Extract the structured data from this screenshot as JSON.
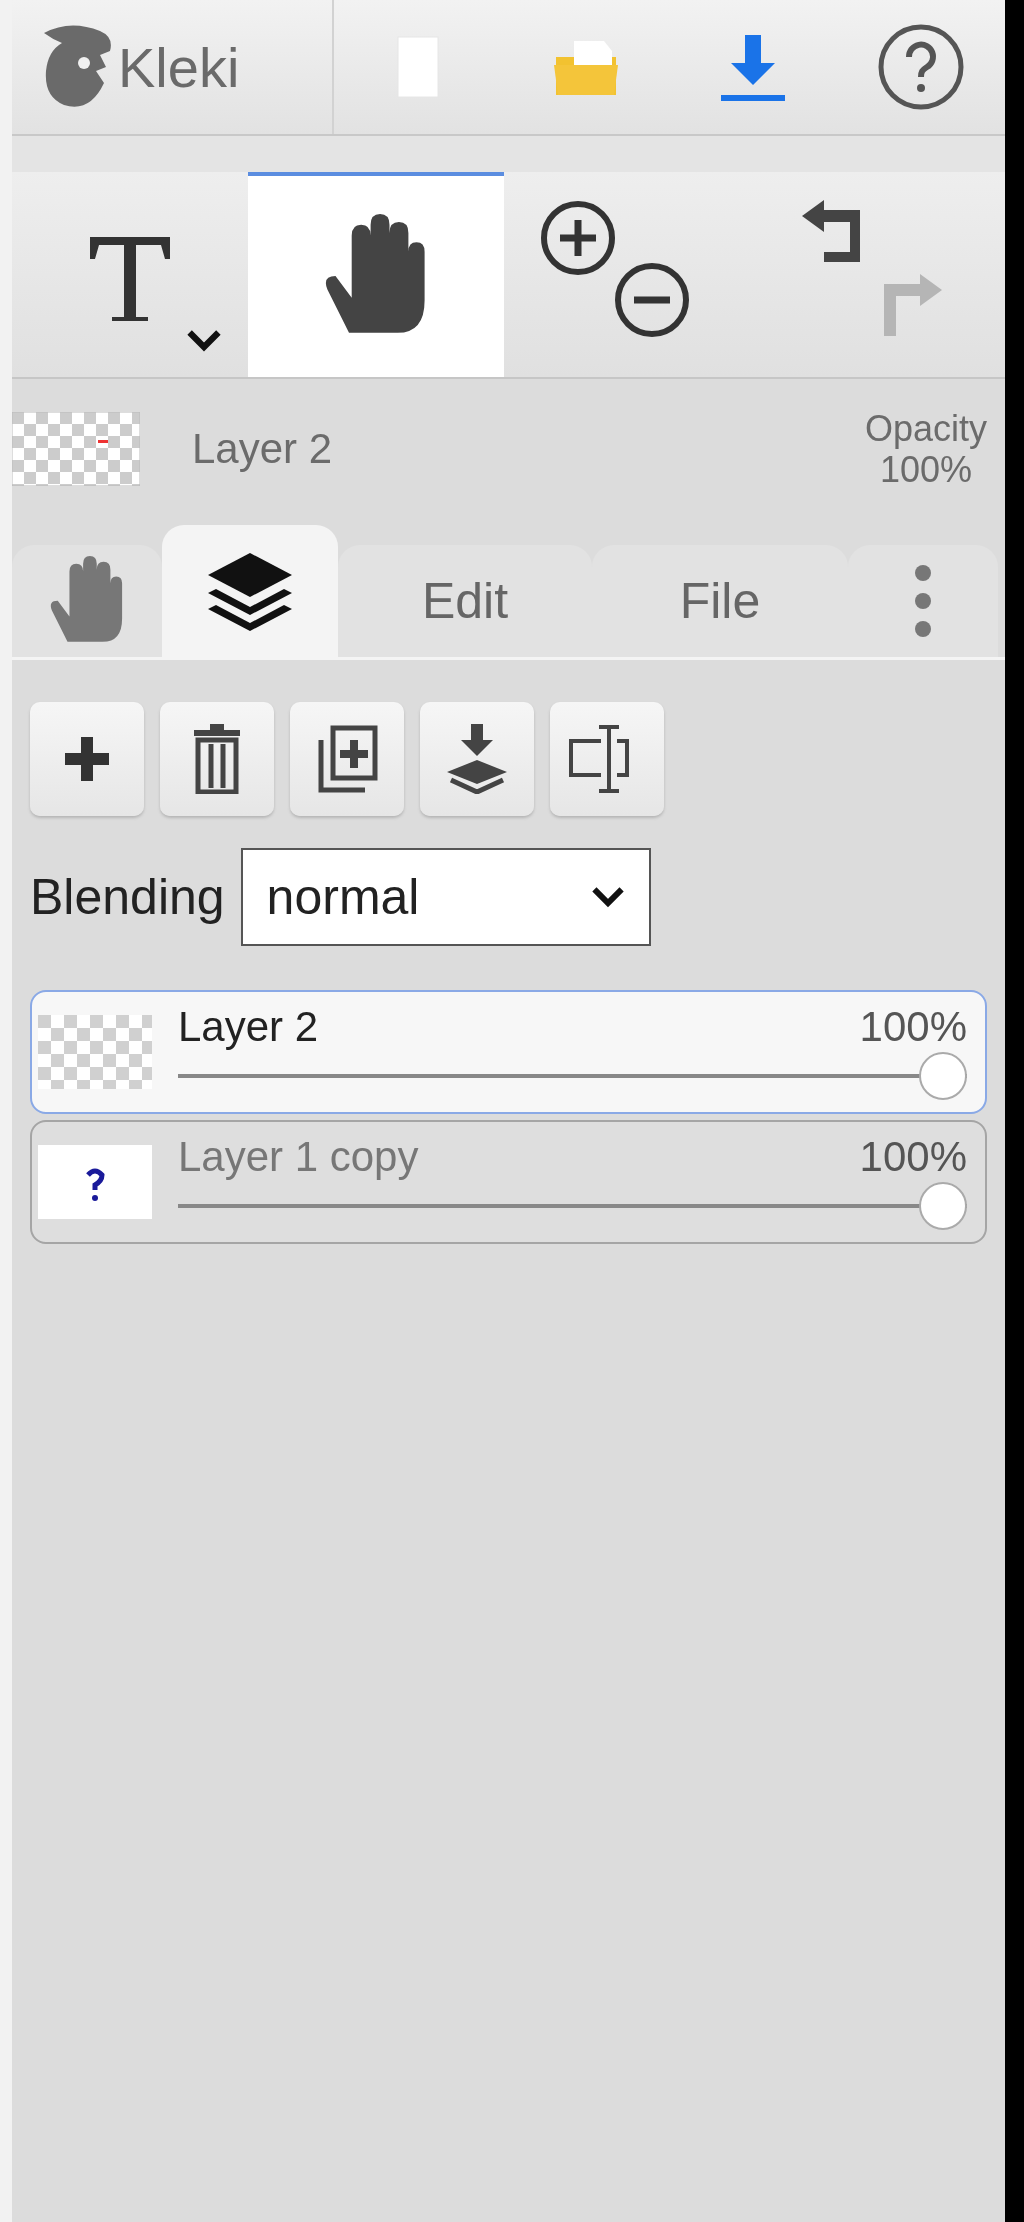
{
  "header": {
    "logo": "Kleki",
    "buttons": [
      {
        "kind": "new"
      },
      {
        "kind": "open"
      },
      {
        "kind": "save"
      },
      {
        "kind": "help"
      }
    ]
  },
  "toolbar": {
    "tools": [
      {
        "kind": "text",
        "selected": false
      },
      {
        "kind": "hand",
        "selected": true
      }
    ],
    "zoom": [
      {
        "kind": "in"
      },
      {
        "kind": "out"
      }
    ],
    "history": [
      {
        "kind": "undo",
        "disabled": false
      },
      {
        "kind": "redo",
        "disabled": true
      }
    ]
  },
  "layer_info": {
    "name": "Layer 2",
    "opacity_label": "Opacity",
    "opacity": "100%"
  },
  "tabs": [
    {
      "kind": "hand",
      "selected": false
    },
    {
      "kind": "layers",
      "selected": true
    },
    {
      "kind": "text",
      "label": "Edit",
      "selected": false
    },
    {
      "kind": "text",
      "label": "File",
      "selected": false
    },
    {
      "kind": "more",
      "selected": false
    }
  ],
  "layer_actions": [
    {
      "kind": "add"
    },
    {
      "kind": "delete"
    },
    {
      "kind": "duplicate"
    },
    {
      "kind": "merge"
    },
    {
      "kind": "rename"
    }
  ],
  "blending": {
    "label": "Blending",
    "value": "normal"
  },
  "layers": [
    {
      "name": "Layer 2",
      "opacity": "100%",
      "level": 1,
      "selected": true,
      "kind": "empty"
    },
    {
      "name": "Layer 1 copy",
      "opacity": "100%",
      "level": 1,
      "selected": false,
      "kind": "mark"
    }
  ]
}
